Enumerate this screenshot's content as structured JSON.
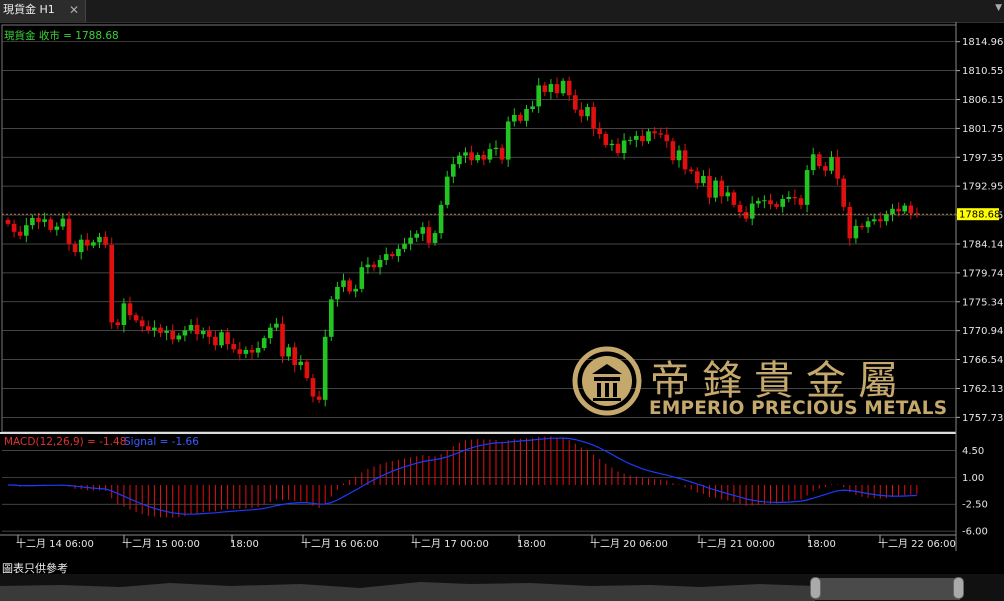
{
  "tab": {
    "title": "現貨金 H1",
    "close": "✕"
  },
  "header_label": "現貨金 收市 = 1788.68",
  "footnote": "圖表只供參考",
  "logo": {
    "chinese": "帝鋒貴金屬",
    "english": "EMPERIO PRECIOUS METALS"
  },
  "colors": {
    "up": "#22c422",
    "down": "#e01010",
    "macd_hist": "#e01010",
    "signal": "#1a3cff",
    "price_label_bg": "#ffff00",
    "grid": "#5a5a5a",
    "close_line": "#b08040"
  },
  "chart_data": [
    {
      "type": "candlestick",
      "title": "現貨金 收市 = 1788.68",
      "ylim": [
        1755.5,
        1817.5
      ],
      "y_ticks": [
        "1814.96",
        "1810.55",
        "1806.15",
        "1801.75",
        "1797.35",
        "1792.95",
        "1788.55",
        "1784.14",
        "1779.74",
        "1775.34",
        "1770.94",
        "1766.54",
        "1762.13",
        "1757.73"
      ],
      "last_price": "1788.68",
      "x_labels": [
        "十二月 14 06:00",
        "十二月 15 00:00",
        "18:00",
        "十二月 16 06:00",
        "十二月 17 00:00",
        "18:00",
        "十二月 20 06:00",
        "十二月 21 00:00",
        "18:00",
        "十二月 22 06:00"
      ],
      "closes": [
        1787.2,
        1786.0,
        1785.4,
        1787.0,
        1788.1,
        1787.5,
        1787.9,
        1786.3,
        1786.8,
        1788.0,
        1784.1,
        1782.9,
        1784.8,
        1783.9,
        1784.4,
        1785.2,
        1784.0,
        1772.2,
        1771.8,
        1775.1,
        1773.3,
        1772.5,
        1771.6,
        1771.0,
        1771.4,
        1770.6,
        1770.9,
        1769.6,
        1770.2,
        1771.0,
        1771.8,
        1770.4,
        1770.9,
        1770.0,
        1768.7,
        1770.7,
        1768.9,
        1768.1,
        1767.4,
        1768.0,
        1767.6,
        1768.3,
        1769.8,
        1771.4,
        1772.0,
        1767.0,
        1768.4,
        1765.7,
        1766.2,
        1763.7,
        1760.9,
        1760.4,
        1770.0,
        1775.7,
        1777.6,
        1778.6,
        1776.9,
        1777.3,
        1780.6,
        1781.0,
        1780.6,
        1781.7,
        1782.6,
        1782.3,
        1783.4,
        1784.2,
        1785.1,
        1785.7,
        1786.7,
        1784.3,
        1785.8,
        1790.1,
        1794.4,
        1796.3,
        1797.6,
        1798.1,
        1796.9,
        1797.7,
        1797.0,
        1798.6,
        1798.8,
        1797.0,
        1802.8,
        1803.8,
        1802.9,
        1804.7,
        1805.1,
        1808.3,
        1807.3,
        1808.5,
        1807.1,
        1809.0,
        1806.8,
        1804.6,
        1803.6,
        1805.0,
        1801.7,
        1800.9,
        1799.2,
        1799.4,
        1798.0,
        1799.9,
        1800.0,
        1800.6,
        1799.8,
        1801.3,
        1801.0,
        1800.8,
        1799.8,
        1796.9,
        1798.4,
        1795.5,
        1795.2,
        1793.4,
        1794.5,
        1791.2,
        1793.8,
        1791.4,
        1792.0,
        1790.1,
        1789.0,
        1788.0,
        1790.3,
        1790.7,
        1790.8,
        1790.2,
        1789.8,
        1791.0,
        1791.3,
        1791.1,
        1790.1,
        1795.4,
        1797.8,
        1796.0,
        1795.3,
        1797.4,
        1794.1,
        1789.8,
        1785.0,
        1786.9,
        1786.7,
        1787.6,
        1787.9,
        1787.6,
        1788.7,
        1789.5,
        1789.1,
        1790.0,
        1788.8,
        1788.68
      ],
      "macd_label": "MACD(12,26,9) = -1.48",
      "signal_label": "Signal = -1.66",
      "macd_ylim": [
        -6.5,
        6.5
      ],
      "macd_ticks": [
        "4.50",
        "1.00",
        "-2.50",
        "-6.00"
      ]
    }
  ]
}
